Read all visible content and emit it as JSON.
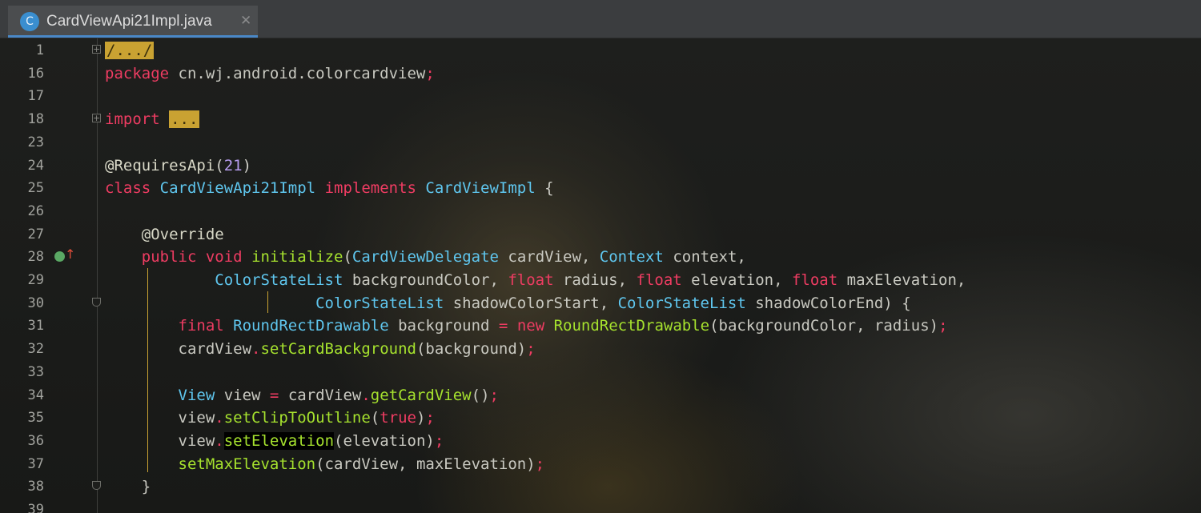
{
  "tab": {
    "icon_letter": "C",
    "title": "CardViewApi21Impl.java",
    "close_glyph": "✕"
  },
  "icons": {
    "fold": "fold-icon",
    "override": "override-method-icon",
    "file": "java-class-icon"
  },
  "colors": {
    "keyword": "#ee3c62",
    "type": "#5fc6ee",
    "function": "#a6e22e",
    "number": "#b79df0",
    "fold_highlight": "#c9a232",
    "tab_accent": "#4a88c7"
  },
  "lines": [
    {
      "n": "1",
      "tokens": [
        [
          "fold-text",
          "/.../"
        ]
      ]
    },
    {
      "n": "16",
      "tokens": [
        [
          "kw",
          "package"
        ],
        [
          "id",
          " cn.wj.android.colorcardview"
        ],
        [
          "sc",
          ";"
        ]
      ]
    },
    {
      "n": "17",
      "tokens": []
    },
    {
      "n": "18",
      "tokens": [
        [
          "kw",
          "import"
        ],
        [
          "id",
          " "
        ],
        [
          "fold-text",
          "..."
        ]
      ]
    },
    {
      "n": "23",
      "tokens": []
    },
    {
      "n": "24",
      "tokens": [
        [
          "ann",
          "@RequiresApi"
        ],
        [
          "pn",
          "("
        ],
        [
          "num",
          "21"
        ],
        [
          "pn",
          ")"
        ]
      ]
    },
    {
      "n": "25",
      "tokens": [
        [
          "kw",
          "class"
        ],
        [
          "id",
          " "
        ],
        [
          "typ",
          "CardViewApi21Impl"
        ],
        [
          "id",
          " "
        ],
        [
          "kw",
          "implements"
        ],
        [
          "id",
          " "
        ],
        [
          "typ",
          "CardViewImpl"
        ],
        [
          "pn",
          " {"
        ]
      ]
    },
    {
      "n": "26",
      "tokens": []
    },
    {
      "n": "27",
      "tokens": [
        [
          "id",
          "    "
        ],
        [
          "ann",
          "@Override"
        ]
      ]
    },
    {
      "n": "28",
      "tokens": [
        [
          "id",
          "    "
        ],
        [
          "kw",
          "public"
        ],
        [
          "id",
          " "
        ],
        [
          "kw",
          "void"
        ],
        [
          "id",
          " "
        ],
        [
          "fn",
          "initialize"
        ],
        [
          "pn",
          "("
        ],
        [
          "typ",
          "CardViewDelegate"
        ],
        [
          "id",
          " cardView, "
        ],
        [
          "typ",
          "Context"
        ],
        [
          "id",
          " context,"
        ]
      ]
    },
    {
      "n": "29",
      "tokens": [
        [
          "id",
          "            "
        ],
        [
          "typ",
          "ColorStateList"
        ],
        [
          "id",
          " backgroundColor, "
        ],
        [
          "kw",
          "float"
        ],
        [
          "id",
          " radius, "
        ],
        [
          "kw",
          "float"
        ],
        [
          "id",
          " elevation, "
        ],
        [
          "kw",
          "float"
        ],
        [
          "id",
          " maxElevation,"
        ]
      ]
    },
    {
      "n": "30",
      "tokens": [
        [
          "id",
          "                       "
        ],
        [
          "typ",
          "ColorStateList"
        ],
        [
          "id",
          " shadowColorStart, "
        ],
        [
          "typ",
          "ColorStateList"
        ],
        [
          "id",
          " shadowColorEnd) {"
        ]
      ]
    },
    {
      "n": "31",
      "tokens": [
        [
          "id",
          "        "
        ],
        [
          "kw",
          "final"
        ],
        [
          "id",
          " "
        ],
        [
          "typ",
          "RoundRectDrawable"
        ],
        [
          "id",
          " background "
        ],
        [
          "kw",
          "="
        ],
        [
          "id",
          " "
        ],
        [
          "kw",
          "new"
        ],
        [
          "id",
          " "
        ],
        [
          "fn",
          "RoundRectDrawable"
        ],
        [
          "pn",
          "("
        ],
        [
          "id",
          "backgroundColor, radius)"
        ],
        [
          "sc",
          ";"
        ]
      ]
    },
    {
      "n": "32",
      "tokens": [
        [
          "id",
          "        cardView"
        ],
        [
          "dot",
          "."
        ],
        [
          "fn",
          "setCardBackground"
        ],
        [
          "id",
          "(background)"
        ],
        [
          "sc",
          ";"
        ]
      ]
    },
    {
      "n": "33",
      "tokens": []
    },
    {
      "n": "34",
      "tokens": [
        [
          "id",
          "        "
        ],
        [
          "typ",
          "View"
        ],
        [
          "id",
          " view "
        ],
        [
          "kw",
          "="
        ],
        [
          "id",
          " cardView"
        ],
        [
          "dot",
          "."
        ],
        [
          "fn",
          "getCardView"
        ],
        [
          "id",
          "()"
        ],
        [
          "sc",
          ";"
        ]
      ]
    },
    {
      "n": "35",
      "tokens": [
        [
          "id",
          "        view"
        ],
        [
          "dot",
          "."
        ],
        [
          "fn",
          "setClipToOutline"
        ],
        [
          "id",
          "("
        ],
        [
          "kw",
          "true"
        ],
        [
          "id",
          ")"
        ],
        [
          "sc",
          ";"
        ]
      ]
    },
    {
      "n": "36",
      "tokens": [
        [
          "id",
          "        view"
        ],
        [
          "dot",
          "."
        ],
        [
          "sel",
          "setElevation"
        ],
        [
          "id",
          "(elevation)"
        ],
        [
          "sc",
          ";"
        ]
      ]
    },
    {
      "n": "37",
      "tokens": [
        [
          "id",
          "        "
        ],
        [
          "fn",
          "setMaxElevation"
        ],
        [
          "id",
          "(cardView, maxElevation)"
        ],
        [
          "sc",
          ";"
        ]
      ]
    },
    {
      "n": "38",
      "tokens": [
        [
          "id",
          "    }"
        ]
      ]
    },
    {
      "n": "39",
      "tokens": []
    }
  ]
}
